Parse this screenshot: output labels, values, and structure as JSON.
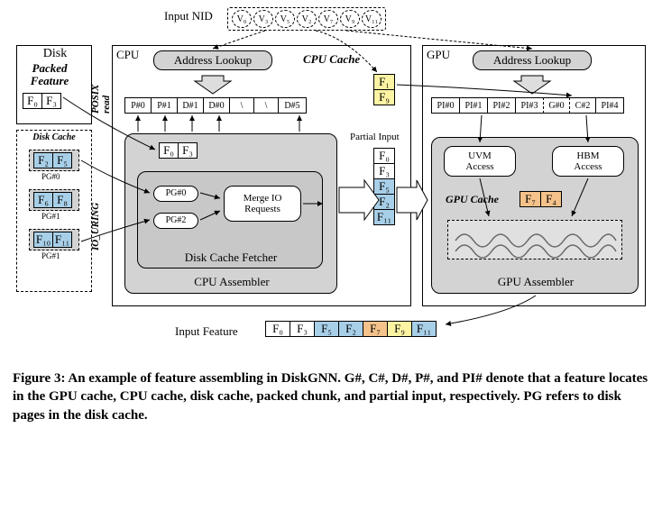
{
  "input_nid_label": "Input NID",
  "input_nids": [
    "V₀",
    "V₃",
    "V₅",
    "V₂",
    "V₇",
    "V₉",
    "V₁₁"
  ],
  "disk": {
    "title": "Disk",
    "packed_feature_label": "Packed\nFeature",
    "packed_features": [
      "F₀",
      "F₃"
    ],
    "posix_read": "POSIX\nread",
    "disk_cache_label": "Disk Cache",
    "io_uring": "IO_URING",
    "pages": [
      {
        "label": "PG#0",
        "features": [
          "F₂",
          "F₅"
        ]
      },
      {
        "label": "PG#1",
        "features": [
          "F₆",
          "F₈"
        ]
      },
      {
        "label": "PG#1",
        "features": [
          "F₁₀",
          "F₁₁"
        ]
      }
    ]
  },
  "cpu": {
    "title": "CPU",
    "address_lookup": "Address Lookup",
    "cpu_cache_label": "CPU Cache",
    "cpu_cache": [
      "F₁",
      "F₉"
    ],
    "address_slots": [
      "P#0",
      "P#1",
      "D#1",
      "D#0",
      "\\",
      "\\",
      "D#5"
    ],
    "packed_features": [
      "F₀",
      "F₃"
    ],
    "pg_inputs": [
      "PG#0",
      "PG#2"
    ],
    "merge_io": "Merge IO\nRequests",
    "disk_cache_fetcher": "Disk Cache Fetcher",
    "cpu_assembler": "CPU Assembler",
    "partial_input_label": "Partial Input",
    "partial_input": [
      "F₀",
      "F₃",
      "F₅",
      "F₂",
      "F₁₁"
    ]
  },
  "gpu": {
    "title": "GPU",
    "address_lookup": "Address Lookup",
    "address_slots": [
      "PI#0",
      "PI#1",
      "PI#2",
      "PI#3",
      "G#0",
      "C#2",
      "PI#4"
    ],
    "uvm_access": "UVM\nAccess",
    "hbm_access": "HBM\nAccess",
    "gpu_cache_label": "GPU Cache",
    "gpu_cache": [
      "F₇",
      "F₄"
    ],
    "gpu_assembler": "GPU Assembler"
  },
  "input_feature_label": "Input Feature",
  "input_feature": [
    {
      "v": "F₀",
      "c": ""
    },
    {
      "v": "F₃",
      "c": ""
    },
    {
      "v": "F₅",
      "c": "blue"
    },
    {
      "v": "F₂",
      "c": "blue"
    },
    {
      "v": "F₇",
      "c": "orange"
    },
    {
      "v": "F₉",
      "c": "yellow"
    },
    {
      "v": "F₁₁",
      "c": "blue"
    }
  ],
  "caption": "Figure 3: An example of feature assembling in DiskGNN. G#, C#, D#, P#, and PI# denote that a feature locates in the GPU cache, CPU cache, disk cache, packed chunk, and partial input, respectively. PG refers to disk pages in the disk cache."
}
